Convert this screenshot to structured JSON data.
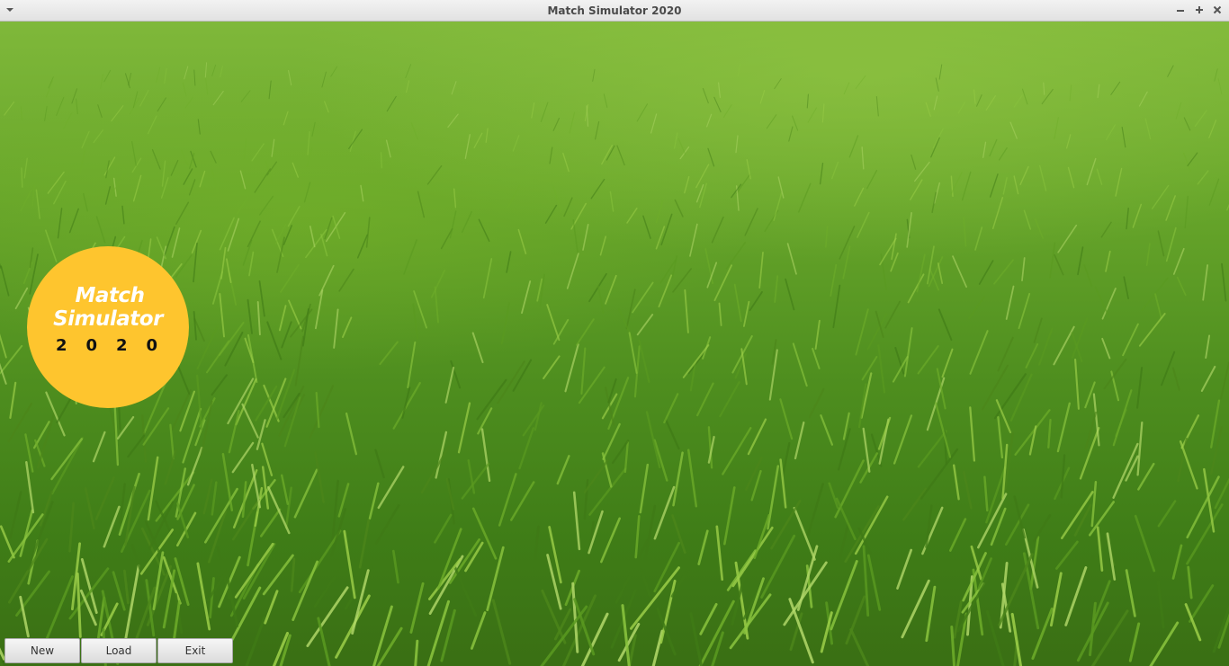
{
  "window": {
    "title": "Match Simulator 2020",
    "controls": {
      "minimize_icon": "minimize-icon",
      "maximize_icon": "maximize-icon",
      "close_icon": "close-icon"
    }
  },
  "background": {
    "image": "artificial grass turf",
    "colors": [
      "#7fb83a",
      "#4f8f1f",
      "#3a6f14"
    ]
  },
  "logo": {
    "line1": "Match",
    "line2": "Simulator",
    "line3": "2020",
    "color": "#fec52e"
  },
  "menu": {
    "new_label": "New",
    "load_label": "Load",
    "exit_label": "Exit"
  }
}
